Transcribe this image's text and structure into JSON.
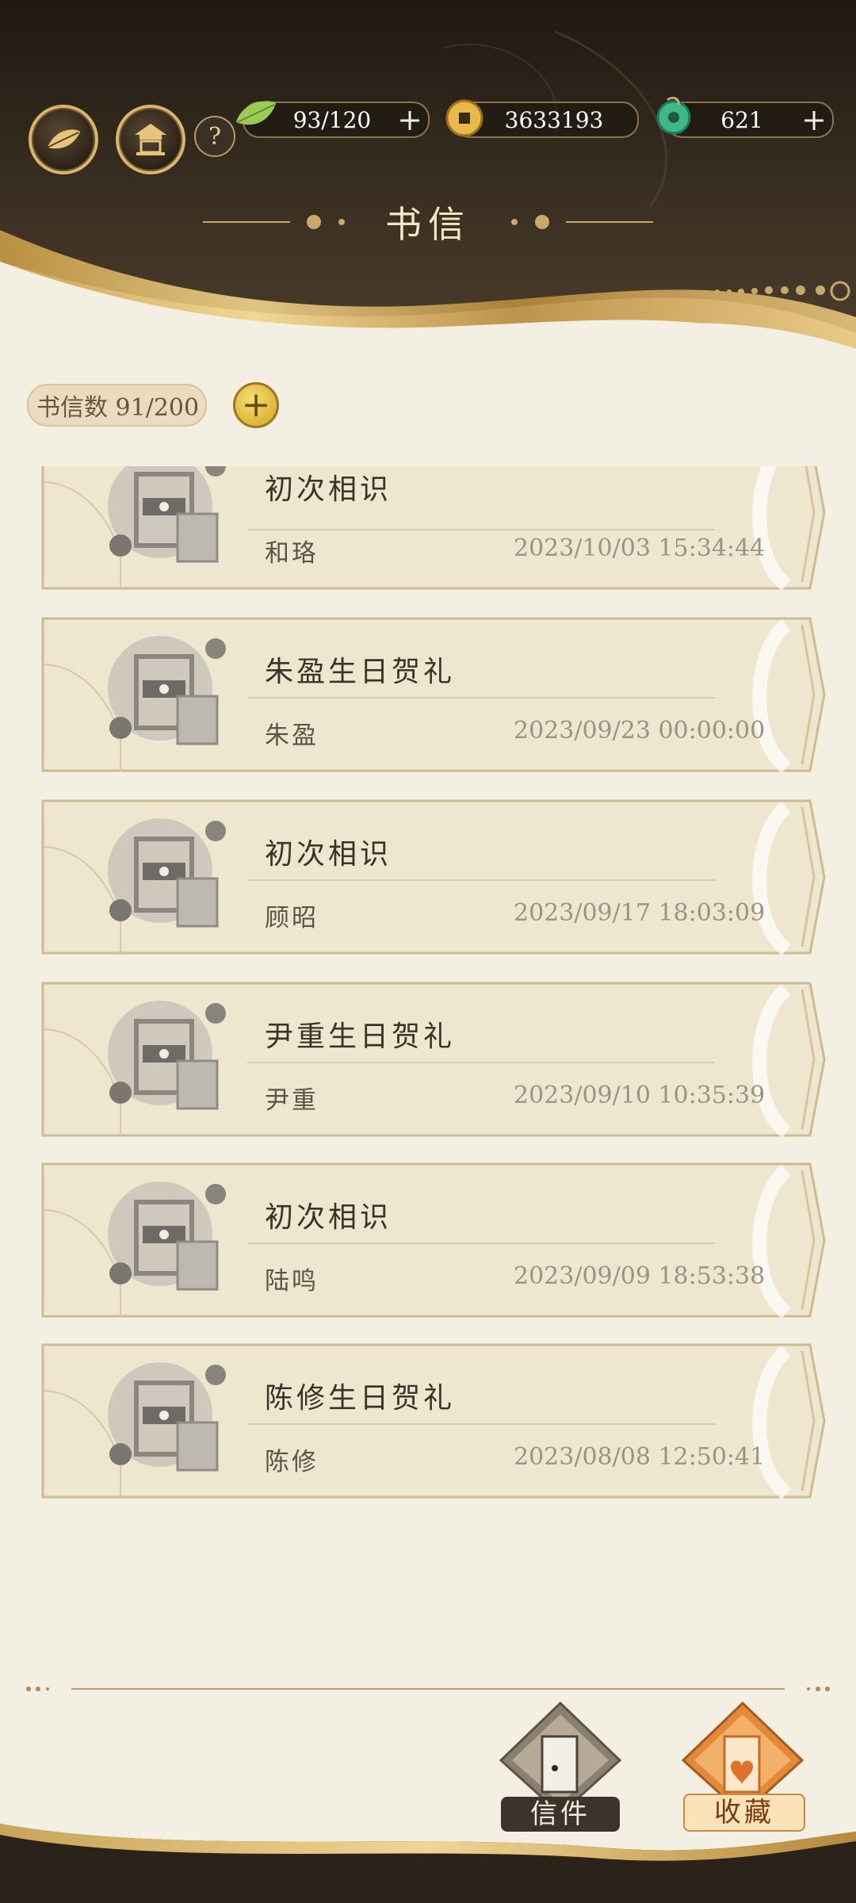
{
  "header": {
    "title": "书信",
    "stamina": "93/120",
    "coins": "3633193",
    "jade": "621",
    "plus": "+",
    "help": "?"
  },
  "counter": {
    "label": "书信数 91/200",
    "add": "+"
  },
  "letters": [
    {
      "subject": "初次相识",
      "sender": "和珞",
      "time": "2023/10/03 15:34:44"
    },
    {
      "subject": "朱盈生日贺礼",
      "sender": "朱盈",
      "time": "2023/09/23 00:00:00"
    },
    {
      "subject": "初次相识",
      "sender": "顾昭",
      "time": "2023/09/17 18:03:09"
    },
    {
      "subject": "尹重生日贺礼",
      "sender": "尹重",
      "time": "2023/09/10 10:35:39"
    },
    {
      "subject": "初次相识",
      "sender": "陆鸣",
      "time": "2023/09/09 18:53:38"
    },
    {
      "subject": "陈修生日贺礼",
      "sender": "陈修",
      "time": "2023/08/08 12:50:41"
    }
  ],
  "tabs": {
    "letters": "信件",
    "favorites": "收藏"
  },
  "colors": {
    "header_dark": "#2b2319",
    "gold": "#d9b46a",
    "paper": "#f3efe2",
    "card": "#eee4cc",
    "active_tab": "#e08a3a"
  }
}
